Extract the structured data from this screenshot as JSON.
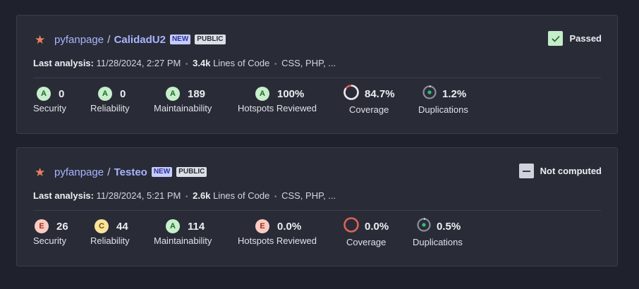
{
  "projects": [
    {
      "org": "pyfanpage",
      "separator": "/",
      "name": "CalidadU2",
      "badge_new": "NEW",
      "badge_public": "PUBLIC",
      "gate_status": "Passed",
      "gate_icon": "check-icon",
      "last_analysis_label": "Last analysis:",
      "last_analysis_value": "11/28/2024, 2:27 PM",
      "loc_value": "3.4k",
      "loc_label": "Lines of Code",
      "languages": "CSS, PHP, ...",
      "metrics": {
        "security": {
          "rating": "A",
          "value": "0",
          "label": "Security"
        },
        "reliability": {
          "rating": "A",
          "value": "0",
          "label": "Reliability"
        },
        "maintainability": {
          "rating": "A",
          "value": "189",
          "label": "Maintainability"
        },
        "hotspots": {
          "rating": "A",
          "value": "100%",
          "label": "Hotspots Reviewed"
        },
        "coverage": {
          "value": "84.7%",
          "label": "Coverage",
          "fraction": 0.847
        },
        "duplications": {
          "value": "1.2%",
          "label": "Duplications",
          "fraction": 0.012
        }
      }
    },
    {
      "org": "pyfanpage",
      "separator": "/",
      "name": "Testeo",
      "badge_new": "NEW",
      "badge_public": "PUBLIC",
      "gate_status": "Not computed",
      "gate_icon": "dash-icon",
      "last_analysis_label": "Last analysis:",
      "last_analysis_value": "11/28/2024, 5:21 PM",
      "loc_value": "2.6k",
      "loc_label": "Lines of Code",
      "languages": "CSS, PHP, ...",
      "metrics": {
        "security": {
          "rating": "E",
          "value": "26",
          "label": "Security"
        },
        "reliability": {
          "rating": "C",
          "value": "44",
          "label": "Reliability"
        },
        "maintainability": {
          "rating": "A",
          "value": "114",
          "label": "Maintainability"
        },
        "hotspots": {
          "rating": "E",
          "value": "0.0%",
          "label": "Hotspots Reviewed"
        },
        "coverage": {
          "value": "0.0%",
          "label": "Coverage",
          "fraction": 0.0
        },
        "duplications": {
          "value": "0.5%",
          "label": "Duplications",
          "fraction": 0.005
        }
      }
    }
  ],
  "colors": {
    "background": "#1f222c",
    "card": "#292c37",
    "link": "#a9b4ff",
    "star": "#e8805f",
    "rating_A": "#c7efcb",
    "rating_C": "#fbe49a",
    "rating_E": "#fbcbc3",
    "coverage_good": "#e6e8ee",
    "coverage_bad": "#e0605a",
    "duplication_dot": "#2fbf71"
  }
}
